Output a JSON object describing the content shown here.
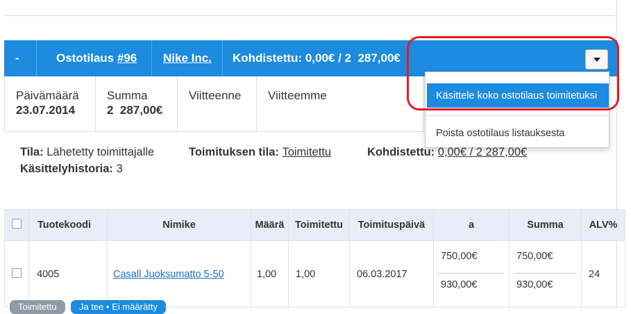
{
  "header": {
    "collapse": "-",
    "order_label": "Ostotilaus",
    "order_number": "#96",
    "supplier": "Nike Inc.",
    "allocated_label": "Kohdistettu:",
    "allocated_value": "0,00€ / 2  287,00€"
  },
  "info": {
    "date_label": "Päivämäärä",
    "date_value": "23.07.2014",
    "sum_label": "Summa",
    "sum_value": "2  287,00€",
    "ref_label": "Viitteenne",
    "ourref_label": "Viitteemme"
  },
  "menu": {
    "item1": "Käsittele koko ostotilaus toimitetuksi",
    "item2": "Poista ostotilaus listauksesta"
  },
  "status": {
    "state_label": "Tila:",
    "state_value": "Lähetetty toimittajalle",
    "delivery_label": "Toimituksen tila:",
    "delivery_value": "Toimitettu",
    "alloc_label": "Kohdistettu:",
    "alloc_value": "0,00€ / 2 287,00€",
    "history_label": "Käsittelyhistoria:",
    "history_value": "3"
  },
  "table": {
    "headers": [
      "Tuotekoodi",
      "Nimike",
      "Määrä",
      "Toimitettu",
      "Toimituspäivä",
      "a",
      "Summa",
      "ALV%"
    ],
    "row": {
      "code": "4005",
      "name": "Casall Juoksumatto 5-50",
      "qty": "1,00",
      "delivered": "1,00",
      "date": "06.03.2017",
      "unit_price1": "750,00€",
      "unit_price2": "930,00€",
      "sum1": "750,00€",
      "sum2": "930,00€",
      "vat": "24"
    }
  },
  "bottom": {
    "btn1": "Toimitettu",
    "btn2": "Ja tee • Ei  määrätty"
  }
}
